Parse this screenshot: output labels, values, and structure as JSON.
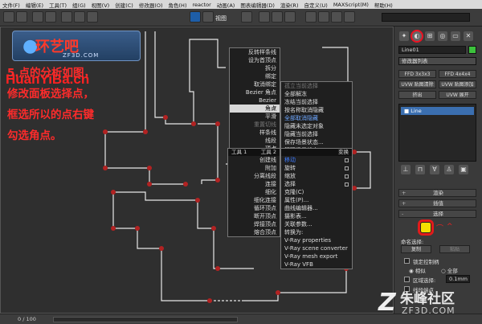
{
  "menubar": {
    "items": [
      "文件(F)",
      "编辑(E)",
      "工具(T)",
      "组(G)",
      "视图(V)",
      "创建(C)",
      "修改器(O)",
      "角色(H)",
      "reactor",
      "动画(A)",
      "图表编辑器(D)",
      "渲染(R)",
      "自定义(U)",
      "MAXScript(M)",
      "帮助(H)"
    ]
  },
  "toolbar": {
    "view_label": "视图"
  },
  "watermark": {
    "logo_cn": "环艺吧",
    "logo_url": "ZF3D.COM",
    "url_text": "HuanYiBa.cn",
    "footer_cn": "朱峰社区",
    "footer_url": "ZF3D.COM"
  },
  "instruction": {
    "text": "5.点的分析如图，修改面板选择点，框选所以的点右键勾选角点。"
  },
  "quad_menu_left": {
    "top_items": [
      "反转样条线",
      "设为首顶点",
      "拆分",
      "绑定",
      "取消绑定",
      "Bezier 角点",
      "Bezier",
      "角点",
      "平滑",
      "重置切线",
      "样条线",
      "线段",
      "顶点",
      "顶层级"
    ],
    "bottom_items": [
      "创建线",
      "附加",
      "分离线段",
      "连接",
      "细化",
      "细化连接",
      "循环顶点",
      "断开顶点",
      "焊接顶点",
      "熔合顶点"
    ]
  },
  "quad_menu_right": {
    "header": "显示",
    "top_items": [
      "孤立当前选择",
      "全部解冻",
      "冻结当前选择",
      "按名称取消隐藏",
      "全部取消隐藏",
      "隐藏未选定对象",
      "隐藏当前选择",
      "保存场景状态...",
      "管理场景状态..."
    ],
    "bottom_header_left": "工具 1",
    "bottom_header_mid": "工具 2",
    "bottom_header_right": "变换",
    "bottom_items": [
      "移动",
      "旋转",
      "缩放",
      "选择",
      "克隆(C)",
      "属性(P)...",
      "曲线编辑器...",
      "摄影表...",
      "关联参数...",
      "转换为:",
      "V-Ray properties",
      "V-Ray scene converter",
      "V-Ray mesh export",
      "V-Ray VFB"
    ]
  },
  "command_panel": {
    "object_name": "Line01",
    "modifier_list": "修改器列表",
    "buttons": [
      "FFD 3x3x3",
      "FFD 4x4x4",
      "UVW 贴图清除",
      "UVW 贴图添加",
      "挤出",
      "UVW 展开"
    ],
    "stack_item": "Line",
    "rollouts": [
      "渲染",
      "插值",
      "选择"
    ],
    "named_sel": "命名选择:",
    "copy_btn": "复制",
    "paste_btn": "粘贴",
    "lock_handles": "锁定控制柄",
    "similar": "相似",
    "all": "全部",
    "area_sel": "区域选择:",
    "area_val": "0.1mm",
    "segment_end": "线段端点"
  },
  "statusbar": {
    "frame": "0 / 100"
  },
  "colors": {
    "accent_red": "#ff2b2b",
    "menu_highlight": "#d8d8d8",
    "selected_blue": "#3d7bff"
  }
}
